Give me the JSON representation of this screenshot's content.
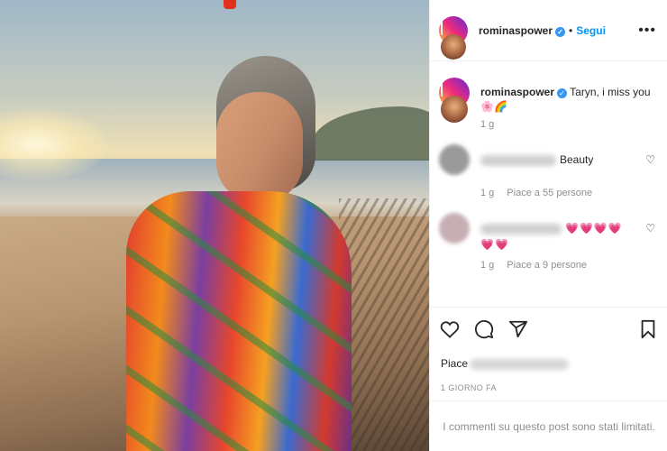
{
  "post": {
    "username": "rominaspower",
    "follow_label": "Segui",
    "more_label": "•••",
    "caption": "Taryn, i miss you 🌸🌈",
    "caption_age": "1 g"
  },
  "comments": [
    {
      "text": "Beauty",
      "age": "1 g",
      "likes": "Piace a 55 persone"
    },
    {
      "text": "💗💗💗💗💗💗",
      "age": "1 g",
      "likes": "Piace a 9 persone"
    }
  ],
  "likes_prefix": "Piace",
  "timestamp": "1 GIORNO FA",
  "comments_limited": "I commenti su questo post sono stati limitati.",
  "icons": {
    "like": "heart-icon",
    "comment": "comment-icon",
    "share": "paper-plane-icon",
    "save": "bookmark-icon"
  },
  "colors": {
    "accent": "#0095f6",
    "verified": "#3897f0",
    "muted": "#8e8e8e",
    "heart": "#e8336d"
  }
}
